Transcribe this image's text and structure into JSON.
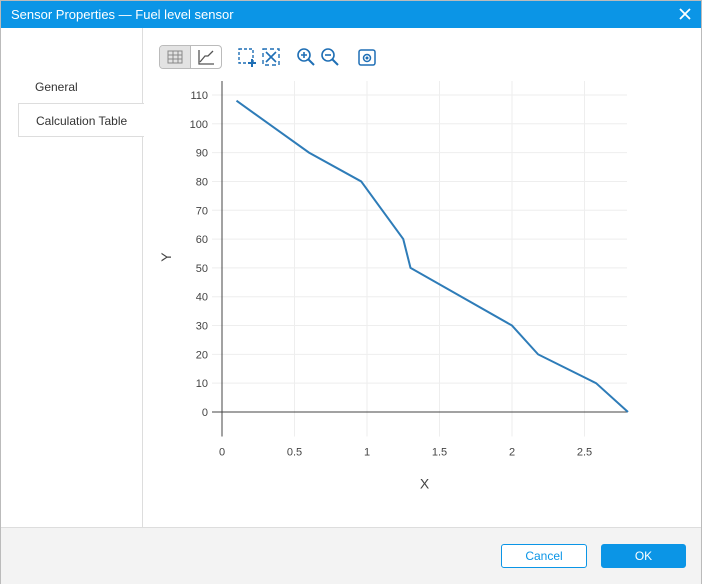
{
  "window": {
    "title": "Sensor Properties — Fuel level sensor"
  },
  "tabs": [
    {
      "label": "General"
    },
    {
      "label": "Calculation Table"
    }
  ],
  "toolbar": {
    "icons": [
      "table-view-icon",
      "chart-view-icon",
      "box-select-icon",
      "autoscale-icon",
      "zoom-in-icon",
      "zoom-out-icon",
      "snapshot-icon"
    ]
  },
  "footer": {
    "cancel": "Cancel",
    "ok": "OK"
  },
  "chart_data": {
    "type": "line",
    "title": "",
    "xlabel": "X",
    "ylabel": "Y",
    "x": [
      0.1,
      0.6,
      0.96,
      1.25,
      1.3,
      2.0,
      2.18,
      2.58,
      2.8
    ],
    "y": [
      108,
      90,
      80,
      60,
      50,
      30,
      20,
      10,
      0
    ],
    "xlim": [
      0,
      3
    ],
    "ylim": [
      -8.5,
      116
    ],
    "xticks": [
      "0",
      "0.5",
      "1",
      "1.5",
      "2",
      "2.5"
    ],
    "yticks": [
      "0",
      "10",
      "20",
      "30",
      "40",
      "50",
      "60",
      "70",
      "80",
      "90",
      "100",
      "110"
    ],
    "grid": true,
    "line_color": "#2e7cb8"
  }
}
